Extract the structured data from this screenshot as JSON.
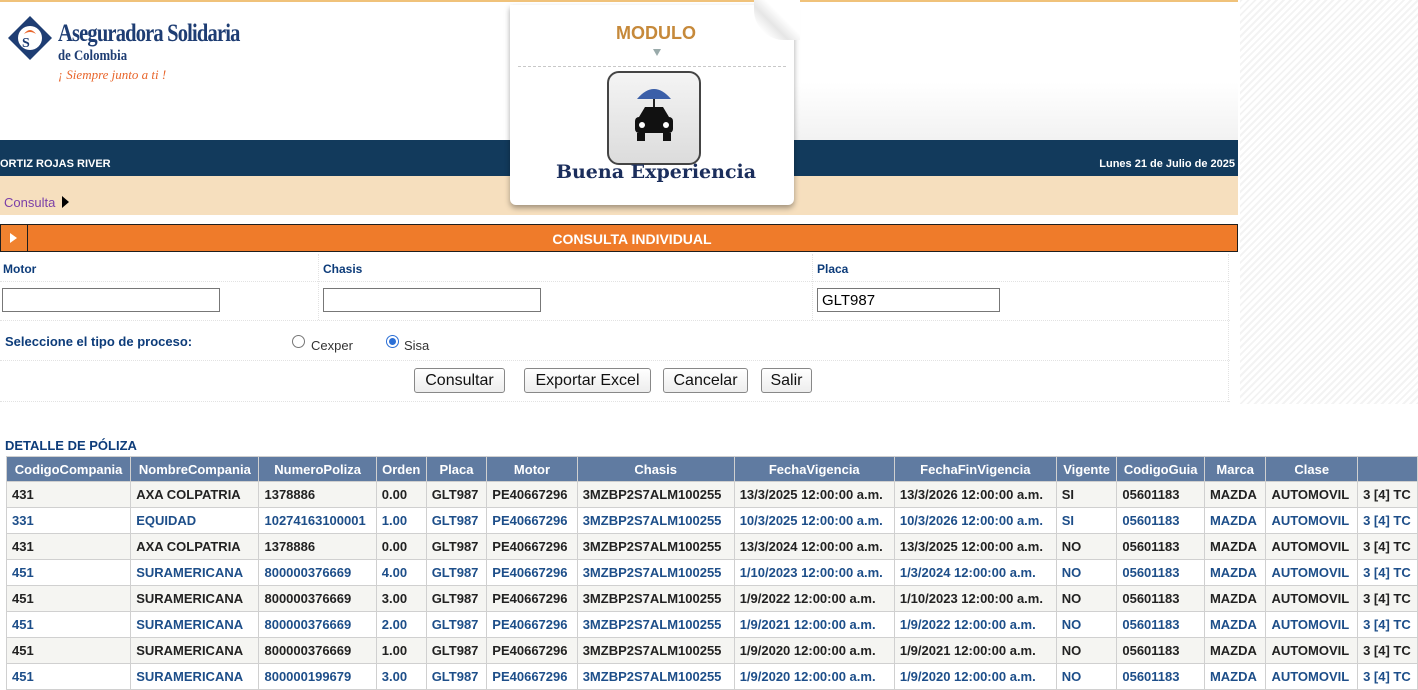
{
  "header": {
    "company_name": "Aseguradora Solidaria",
    "company_sub": "de Colombia",
    "tagline": "¡ Siempre junto a ti !",
    "module_label": "MODULO",
    "module_title": "Buena Experiencia",
    "user_name": "ORTIZ ROJAS RIVER",
    "date": "Lunes 21 de Julio de 2025"
  },
  "breadcrumb": {
    "label": "Consulta"
  },
  "section": {
    "title": "CONSULTA INDIVIDUAL"
  },
  "form": {
    "motor_label": "Motor",
    "motor_value": "",
    "chasis_label": "Chasis",
    "chasis_value": "",
    "placa_label": "Placa",
    "placa_value": "GLT987",
    "process_label": "Seleccione el tipo de proceso:",
    "option_cexper": "Cexper",
    "option_sisa": "Sisa",
    "selected_option": "Sisa"
  },
  "buttons": {
    "consultar": "Consultar",
    "exportar": "Exportar Excel",
    "cancelar": "Cancelar",
    "salir": "Salir"
  },
  "detail": {
    "title": "DETALLE DE PÓLIZA",
    "columns": [
      "CodigoCompania",
      "NombreCompania",
      "NumeroPoliza",
      "Orden",
      "Placa",
      "Motor",
      "Chasis",
      "FechaVigencia",
      "FechaFinVigencia",
      "Vigente",
      "CodigoGuia",
      "Marca",
      "Clase",
      ""
    ],
    "rows": [
      [
        "431",
        "AXA COLPATRIA",
        "1378886",
        "0.00",
        "GLT987",
        "PE40667296",
        "3MZBP2S7ALM100255",
        "13/3/2025 12:00:00 a.m.",
        "13/3/2026 12:00:00 a.m.",
        "SI",
        "05601183",
        "MAZDA",
        "AUTOMOVIL",
        "3 [4] TC"
      ],
      [
        "331",
        "EQUIDAD",
        "10274163100001",
        "1.00",
        "GLT987",
        "PE40667296",
        "3MZBP2S7ALM100255",
        "10/3/2025 12:00:00 a.m.",
        "10/3/2026 12:00:00 a.m.",
        "SI",
        "05601183",
        "MAZDA",
        "AUTOMOVIL",
        "3 [4] TC"
      ],
      [
        "431",
        "AXA COLPATRIA",
        "1378886",
        "0.00",
        "GLT987",
        "PE40667296",
        "3MZBP2S7ALM100255",
        "13/3/2024 12:00:00 a.m.",
        "13/3/2025 12:00:00 a.m.",
        "NO",
        "05601183",
        "MAZDA",
        "AUTOMOVIL",
        "3 [4] TC"
      ],
      [
        "451",
        "SURAMERICANA",
        "800000376669",
        "4.00",
        "GLT987",
        "PE40667296",
        "3MZBP2S7ALM100255",
        "1/10/2023 12:00:00 a.m.",
        "1/3/2024 12:00:00 a.m.",
        "NO",
        "05601183",
        "MAZDA",
        "AUTOMOVIL",
        "3 [4] TC"
      ],
      [
        "451",
        "SURAMERICANA",
        "800000376669",
        "3.00",
        "GLT987",
        "PE40667296",
        "3MZBP2S7ALM100255",
        "1/9/2022 12:00:00 a.m.",
        "1/10/2023 12:00:00 a.m.",
        "NO",
        "05601183",
        "MAZDA",
        "AUTOMOVIL",
        "3 [4] TC"
      ],
      [
        "451",
        "SURAMERICANA",
        "800000376669",
        "2.00",
        "GLT987",
        "PE40667296",
        "3MZBP2S7ALM100255",
        "1/9/2021 12:00:00 a.m.",
        "1/9/2022 12:00:00 a.m.",
        "NO",
        "05601183",
        "MAZDA",
        "AUTOMOVIL",
        "3 [4] TC"
      ],
      [
        "451",
        "SURAMERICANA",
        "800000376669",
        "1.00",
        "GLT987",
        "PE40667296",
        "3MZBP2S7ALM100255",
        "1/9/2020 12:00:00 a.m.",
        "1/9/2021 12:00:00 a.m.",
        "NO",
        "05601183",
        "MAZDA",
        "AUTOMOVIL",
        "3 [4] TC"
      ],
      [
        "451",
        "SURAMERICANA",
        "800000199679",
        "3.00",
        "GLT987",
        "PE40667296",
        "3MZBP2S7ALM100255",
        "1/9/2020 12:00:00 a.m.",
        "1/9/2020 12:00:00 a.m.",
        "NO",
        "05601183",
        "MAZDA",
        "AUTOMOVIL",
        "3 [4] TC"
      ]
    ]
  },
  "icons": {
    "logo": "company-logo-icon",
    "module": "car-umbrella-icon",
    "breadcrumb_arrow": "triangle-right-icon",
    "section_toggle": "play-icon"
  },
  "colors": {
    "navy": "#123a5c",
    "orange": "#ef7b2a",
    "peach": "#f6dfbe",
    "table_header": "#607ba1",
    "label_blue": "#0d3c7a"
  }
}
